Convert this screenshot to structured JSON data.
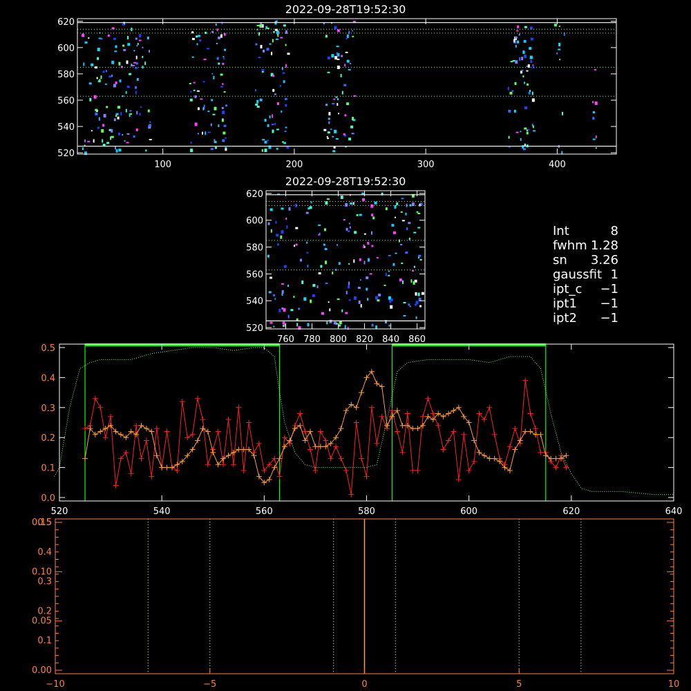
{
  "colors": {
    "background": "#000000",
    "axis_white": "#ffffff",
    "axis_orange": "#ff8040",
    "red": "#ff2020",
    "orange": "#ffa030",
    "green": "#00ff00",
    "dotted_green": "#88ff88",
    "dotted_yellow": "#ffff88"
  },
  "top_image": {
    "title": "2022-09-28T19:52:30",
    "x_ticks": [
      "100",
      "200",
      "300",
      "400"
    ],
    "y_ticks": [
      "520",
      "540",
      "560",
      "580",
      "600",
      "620"
    ],
    "xlim": [
      35,
      445
    ],
    "ylim": [
      519,
      622
    ]
  },
  "mid_image": {
    "title": "2022-09-28T19:52:30",
    "x_ticks": [
      "760",
      "780",
      "800",
      "820",
      "840",
      "860"
    ],
    "y_ticks": [
      "520",
      "540",
      "560",
      "580",
      "600",
      "620"
    ],
    "xlim": [
      745,
      866
    ],
    "ylim": [
      519,
      622
    ]
  },
  "info_panel": [
    {
      "label": "Int",
      "value": "8"
    },
    {
      "label": "fwhm",
      "value": "1.28"
    },
    {
      "label": "sn",
      "value": "3.26"
    },
    {
      "label": "gaussfit",
      "value": "1"
    },
    {
      "label": "ipt_c",
      "value": "−1"
    },
    {
      "label": "ipt1",
      "value": "−1"
    },
    {
      "label": "ipt2",
      "value": "−1"
    }
  ],
  "chart_data": [
    {
      "type": "line",
      "xlim": [
        520,
        640
      ],
      "ylim": [
        0.0,
        0.5
      ],
      "x_ticks": [
        "520",
        "540",
        "560",
        "580",
        "600",
        "620",
        "640"
      ],
      "y_ticks": [
        "0.0",
        "0.1",
        "0.2",
        "0.3",
        "0.4",
        "0.5"
      ],
      "windows": [
        [
          525,
          563
        ],
        [
          585,
          615
        ]
      ],
      "series": [
        {
          "color": "red",
          "x": [
            525,
            526,
            527,
            528,
            529,
            530,
            531,
            532,
            533,
            534,
            535,
            536,
            537,
            538,
            539,
            540,
            541,
            542,
            543,
            544,
            545,
            546,
            547,
            548,
            549,
            550,
            551,
            552,
            553,
            554,
            555,
            556,
            557,
            558,
            559,
            560,
            561,
            562,
            563,
            564,
            565,
            566,
            567,
            568,
            569,
            570,
            571,
            572,
            573,
            574,
            575,
            576,
            577,
            578,
            579,
            580,
            581,
            582,
            583,
            584,
            585,
            586,
            587,
            588,
            589,
            590,
            591,
            592,
            593,
            594,
            595,
            596,
            597,
            598,
            599,
            600,
            601,
            602,
            603,
            604,
            605,
            606,
            607,
            608,
            609,
            610,
            611,
            612,
            613,
            614,
            615,
            616,
            617,
            618,
            619
          ],
          "y": [
            0.23,
            0.24,
            0.33,
            0.3,
            0.2,
            0.27,
            0.04,
            0.13,
            0.15,
            0.08,
            0.24,
            0.13,
            0.19,
            0.07,
            0.23,
            0.1,
            0.22,
            0.1,
            0.09,
            0.32,
            0.2,
            0.21,
            0.33,
            0.26,
            0.11,
            0.16,
            0.22,
            0.11,
            0.26,
            0.11,
            0.3,
            0.09,
            0.25,
            0.15,
            0.18,
            0.09,
            0.11,
            0.13,
            0.07,
            0.2,
            0.18,
            0.24,
            0.28,
            0.22,
            0.16,
            0.09,
            0.22,
            0.19,
            0.13,
            0.17,
            0.13,
            0.09,
            0.01,
            0.25,
            0.13,
            0.07,
            0.3,
            0.18,
            0.27,
            0.23,
            0.29,
            0.22,
            0.15,
            0.28,
            0.09,
            0.09,
            0.27,
            0.33,
            0.28,
            0.24,
            0.16,
            0.19,
            0.22,
            0.06,
            0.21,
            0.09,
            0.12,
            0.28,
            0.26,
            0.3,
            0.21,
            0.13,
            0.11,
            0.17,
            0.23,
            0.18,
            0.39,
            0.28,
            0.23,
            0.15,
            0.15,
            0.12,
            0.1,
            0.14,
            0.1
          ]
        },
        {
          "color": "orange",
          "x": [
            525,
            526,
            527,
            528,
            529,
            530,
            531,
            532,
            533,
            534,
            535,
            536,
            537,
            538,
            539,
            540,
            541,
            542,
            543,
            544,
            545,
            546,
            547,
            548,
            549,
            550,
            551,
            552,
            553,
            554,
            555,
            556,
            557,
            558,
            559,
            560,
            561,
            562,
            563,
            564,
            565,
            566,
            567,
            568,
            569,
            570,
            571,
            572,
            573,
            574,
            575,
            576,
            577,
            578,
            579,
            580,
            581,
            582,
            583,
            584,
            585,
            586,
            587,
            588,
            589,
            590,
            591,
            592,
            593,
            594,
            595,
            596,
            597,
            598,
            599,
            600,
            601,
            602,
            603,
            604,
            605,
            606,
            607,
            608,
            609,
            610,
            611,
            612,
            613,
            614,
            615,
            616,
            617,
            618,
            619
          ],
          "y": [
            0.13,
            0.23,
            0.21,
            0.22,
            0.23,
            0.24,
            0.22,
            0.21,
            0.2,
            0.22,
            0.21,
            0.24,
            0.23,
            0.22,
            0.14,
            0.1,
            0.1,
            0.1,
            0.11,
            0.12,
            0.14,
            0.16,
            0.19,
            0.23,
            0.22,
            0.15,
            0.11,
            0.13,
            0.14,
            0.15,
            0.16,
            0.16,
            0.16,
            0.14,
            0.07,
            0.05,
            0.06,
            0.1,
            0.13,
            0.17,
            0.19,
            0.23,
            0.24,
            0.19,
            0.22,
            0.17,
            0.17,
            0.17,
            0.18,
            0.2,
            0.23,
            0.29,
            0.31,
            0.3,
            0.35,
            0.4,
            0.42,
            0.38,
            0.37,
            0.24,
            0.27,
            0.29,
            0.24,
            0.24,
            0.23,
            0.23,
            0.24,
            0.27,
            0.26,
            0.28,
            0.27,
            0.28,
            0.29,
            0.3,
            0.27,
            0.25,
            0.19,
            0.15,
            0.14,
            0.13,
            0.13,
            0.12,
            0.1,
            0.09,
            0.16,
            0.19,
            0.22,
            0.22,
            0.21,
            0.21,
            0.14,
            0.13,
            0.13,
            0.13,
            0.14
          ]
        },
        {
          "color": "dotted_green",
          "x": [
            519,
            520,
            522,
            524,
            526,
            528,
            530,
            534,
            538,
            542,
            546,
            550,
            554,
            558,
            560,
            562,
            563,
            564,
            566,
            568,
            570,
            572,
            576,
            580,
            582,
            584,
            586,
            588,
            592,
            596,
            600,
            604,
            608,
            610,
            612,
            614,
            616,
            618,
            620,
            622,
            624,
            630,
            636,
            640
          ],
          "y": [
            0.07,
            0.1,
            0.3,
            0.43,
            0.45,
            0.46,
            0.46,
            0.46,
            0.48,
            0.49,
            0.5,
            0.5,
            0.49,
            0.5,
            0.5,
            0.47,
            0.35,
            0.25,
            0.15,
            0.11,
            0.1,
            0.1,
            0.1,
            0.1,
            0.11,
            0.26,
            0.42,
            0.45,
            0.46,
            0.46,
            0.46,
            0.45,
            0.47,
            0.47,
            0.47,
            0.43,
            0.28,
            0.15,
            0.08,
            0.03,
            0.02,
            0.02,
            0.01,
            0.01
          ]
        }
      ]
    },
    {
      "type": "line",
      "xlim": [
        -10,
        10
      ],
      "x_ticks": [
        "−10",
        "−5",
        "0",
        "5",
        "10"
      ],
      "left_ticks": [
        "0.00",
        "0.05",
        "0.10",
        "0.15"
      ],
      "left_ticks_alt": [
        "0.1",
        "0.2",
        "0.3",
        "0.4",
        "0.5"
      ],
      "dotted_x": [
        -7,
        -5,
        -1,
        1,
        5,
        7
      ],
      "vline_x": 0
    }
  ]
}
